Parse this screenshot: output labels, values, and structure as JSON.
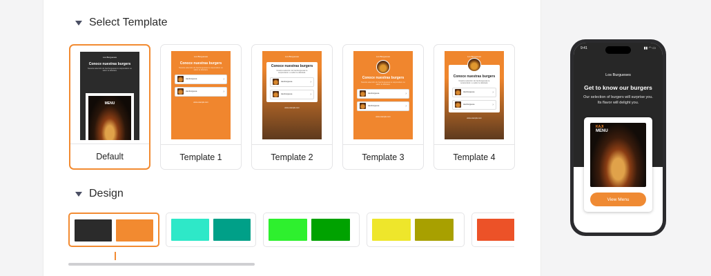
{
  "sections": {
    "template_title": "Select Template",
    "design_title": "Design"
  },
  "templates": [
    {
      "label": "Default",
      "selected": true
    },
    {
      "label": "Template 1",
      "selected": false
    },
    {
      "label": "Template 2",
      "selected": false
    },
    {
      "label": "Template 3",
      "selected": false
    },
    {
      "label": "Template 4",
      "selected": false
    }
  ],
  "mini_content": {
    "brand": "Los Burgueses",
    "heading": "Conoce nuestras burgers",
    "subtext": "Nuestra selección de hamburguesas te sorprenderá. Lo sabor te deleitará.",
    "item_name": "Hamburguesa",
    "item_desc": "Descripción breve del plato",
    "footer": "www.example.com",
    "menu_word": "MENU"
  },
  "designs": [
    {
      "colors": [
        "#2b2b2b",
        "#f28a30"
      ],
      "selected": true
    },
    {
      "colors": [
        "#2ee8c8",
        "#00a088"
      ],
      "selected": false
    },
    {
      "colors": [
        "#2ef02e",
        "#00a200"
      ],
      "selected": false
    },
    {
      "colors": [
        "#eee62b",
        "#a8a000"
      ],
      "selected": false
    },
    {
      "colors": [
        "#ec5228",
        "#c43810"
      ],
      "selected": false
    }
  ],
  "phone": {
    "time": "9:41",
    "brand": "Los Burgueses",
    "title": "Get to know our burgers",
    "subtitle": "Our selection of burgers will surprise you. Its flavor will delight you.",
    "menu_small": "KAJI",
    "menu_word": "MENU",
    "button_label": "View Menu"
  },
  "accent_color": "#f28a30"
}
